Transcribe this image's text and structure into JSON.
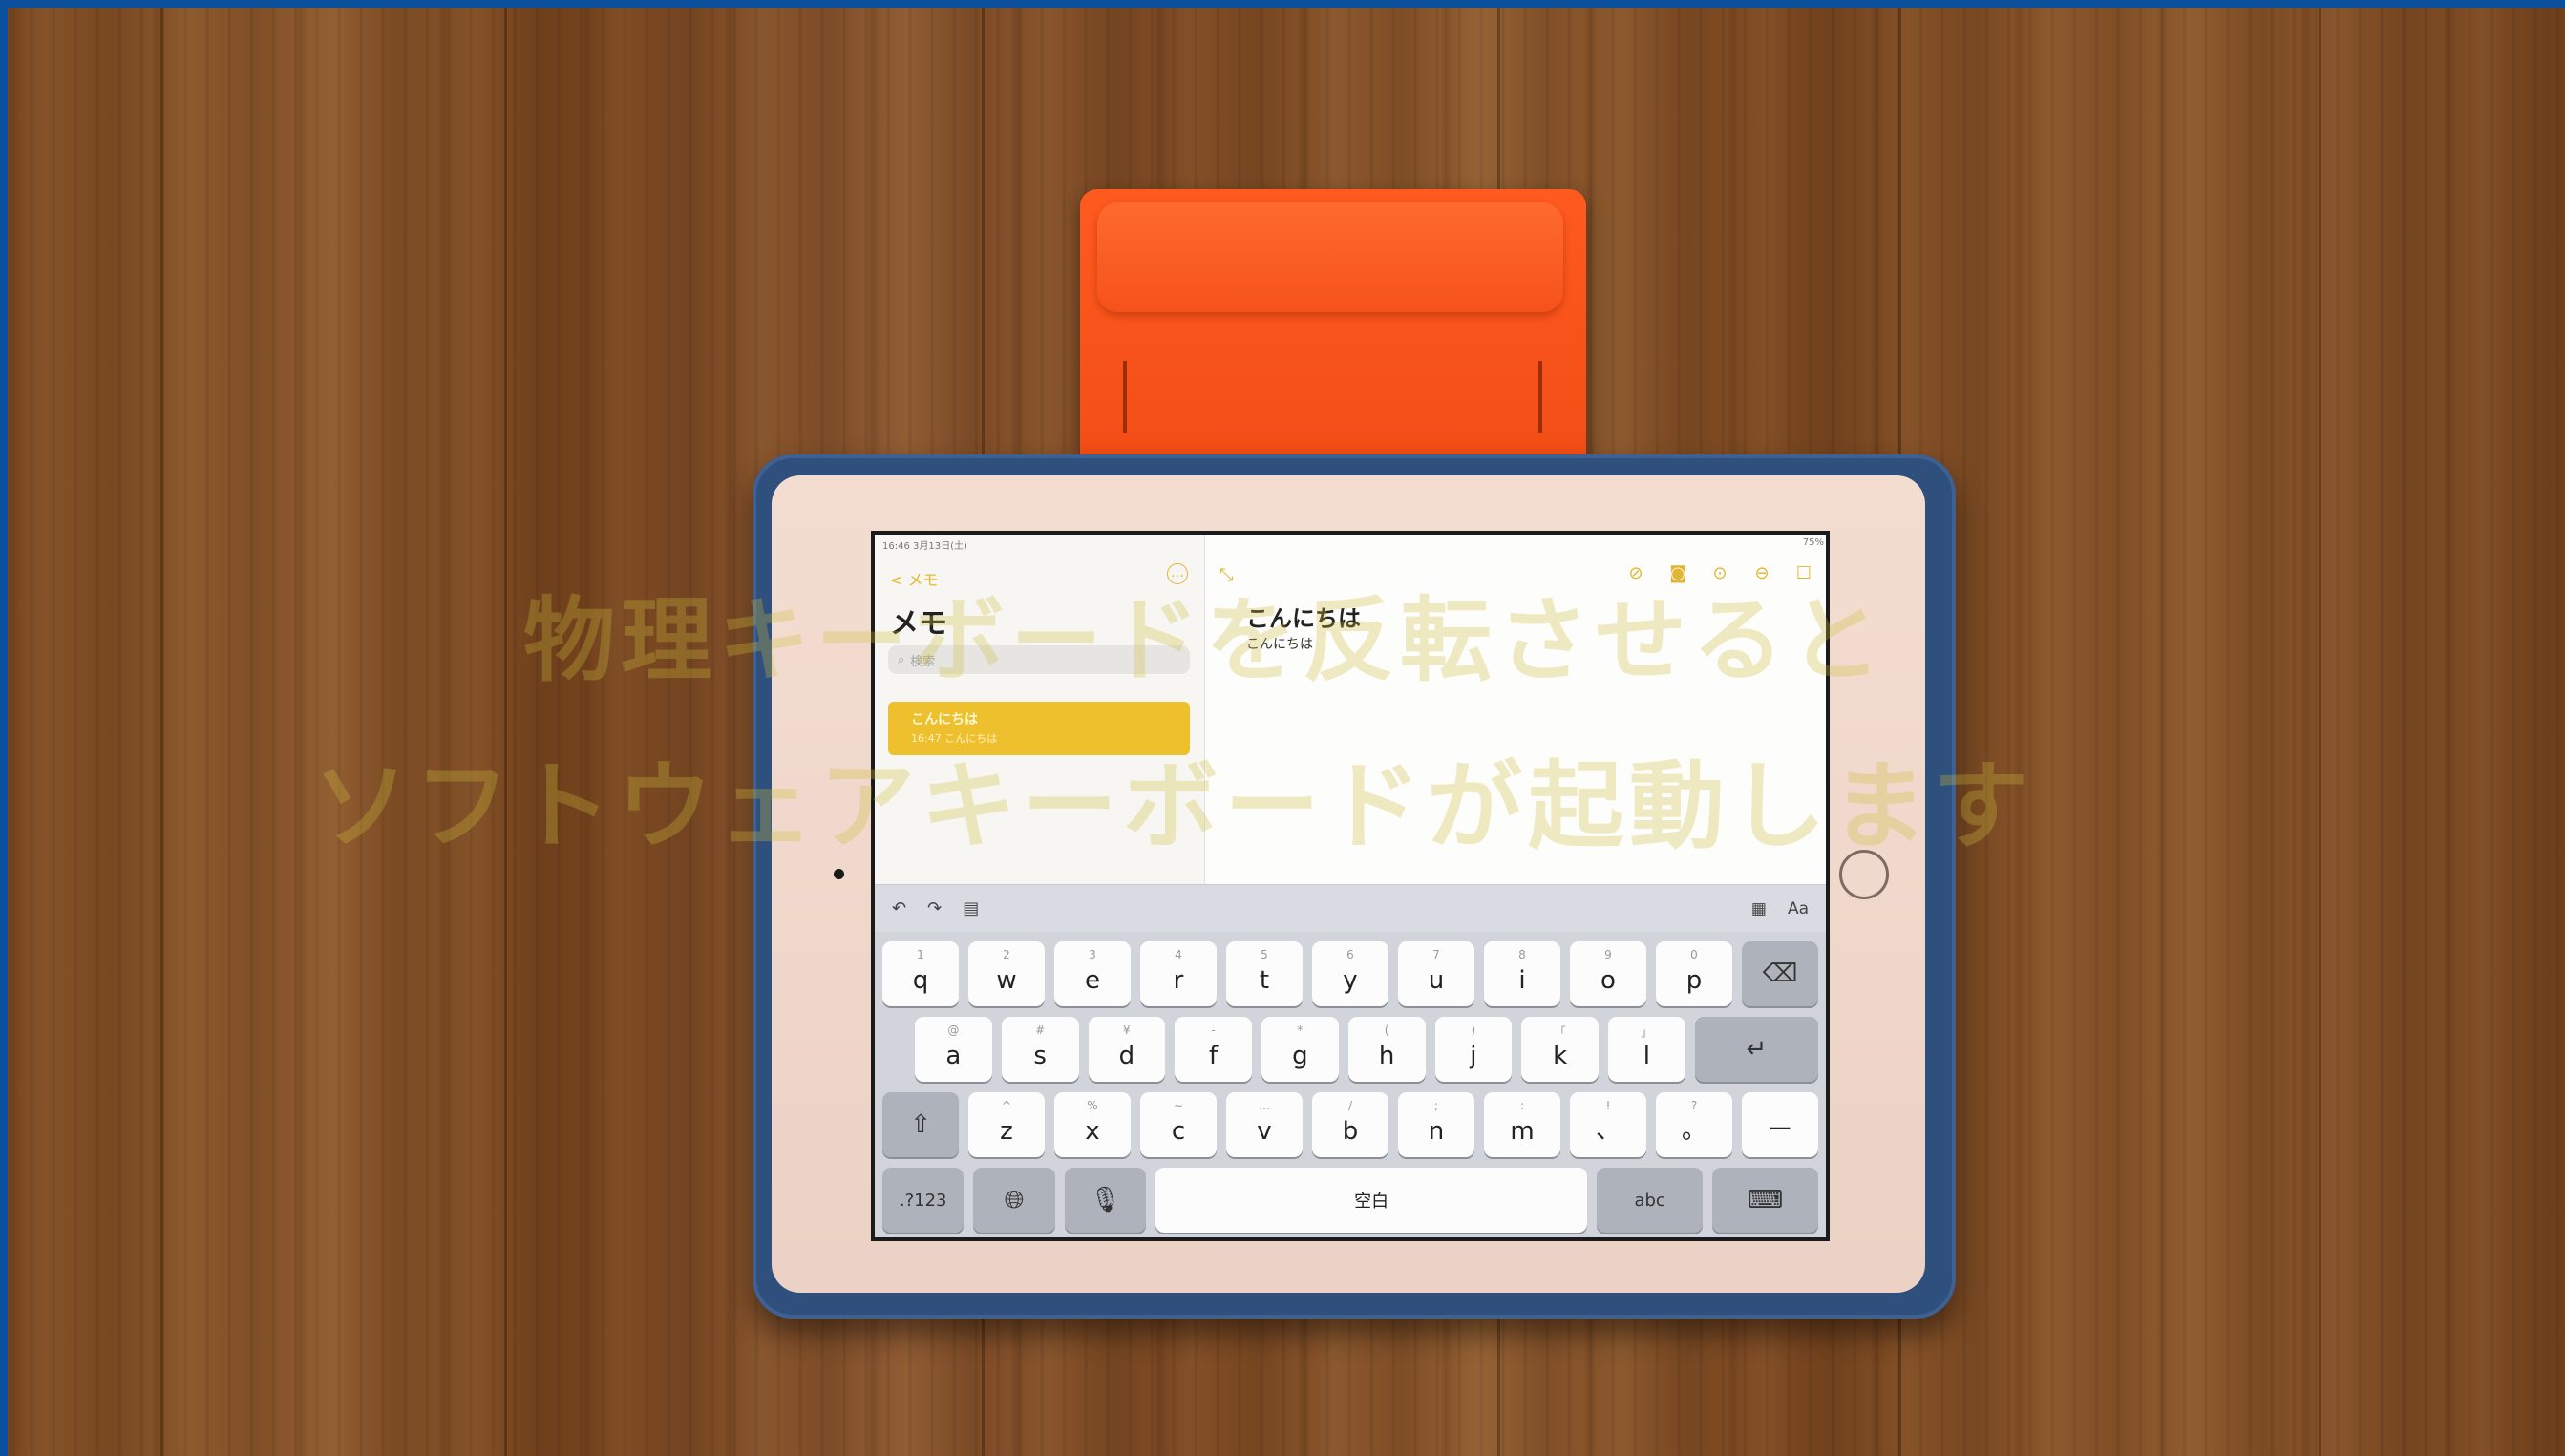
{
  "status_bar": {
    "time": "16:46",
    "date": "3月13日(土)",
    "battery": "75%"
  },
  "sidebar": {
    "back_label": "< メモ",
    "title": "メモ",
    "search_placeholder": "検索",
    "note": {
      "title": "こんにちは",
      "subtitle": "16:47 こんにちは"
    }
  },
  "editor": {
    "title": "こんにちは",
    "body": "こんにちは"
  },
  "icons": {
    "sidebar_more": "more-circle-icon",
    "expand": "expand-icon",
    "tools": [
      "checklist-icon",
      "camera-icon",
      "markup-icon",
      "more-icon",
      "compose-icon"
    ],
    "kb_left": [
      "undo-icon",
      "redo-icon",
      "paste-icon"
    ],
    "kb_right": [
      "table-icon",
      "text-format-icon"
    ]
  },
  "keyboard": {
    "row1": [
      {
        "k": "q",
        "s": "1"
      },
      {
        "k": "w",
        "s": "2"
      },
      {
        "k": "e",
        "s": "3"
      },
      {
        "k": "r",
        "s": "4"
      },
      {
        "k": "t",
        "s": "5"
      },
      {
        "k": "y",
        "s": "6"
      },
      {
        "k": "u",
        "s": "7"
      },
      {
        "k": "i",
        "s": "8"
      },
      {
        "k": "o",
        "s": "9"
      },
      {
        "k": "p",
        "s": "0"
      }
    ],
    "row2": [
      {
        "k": "a",
        "s": "@"
      },
      {
        "k": "s",
        "s": "#"
      },
      {
        "k": "d",
        "s": "¥"
      },
      {
        "k": "f",
        "s": "-"
      },
      {
        "k": "g",
        "s": "*"
      },
      {
        "k": "h",
        "s": "("
      },
      {
        "k": "j",
        "s": ")"
      },
      {
        "k": "k",
        "s": "「"
      },
      {
        "k": "l",
        "s": "」"
      }
    ],
    "row3": [
      {
        "k": "z",
        "s": "^"
      },
      {
        "k": "x",
        "s": "%"
      },
      {
        "k": "c",
        "s": "~"
      },
      {
        "k": "v",
        "s": "…"
      },
      {
        "k": "b",
        "s": "/"
      },
      {
        "k": "n",
        "s": ";"
      },
      {
        "k": "m",
        "s": ":"
      },
      {
        "k": "、",
        "s": "!"
      },
      {
        "k": "。",
        "s": "?"
      }
    ],
    "dash_key": "ー",
    "numbers_key": ".?123",
    "space_key": "空白",
    "abc_key": "abc"
  },
  "captions": {
    "line1": "物理キーボードを反転させると",
    "line2": "ソフトウェアキーボードが起動します"
  }
}
